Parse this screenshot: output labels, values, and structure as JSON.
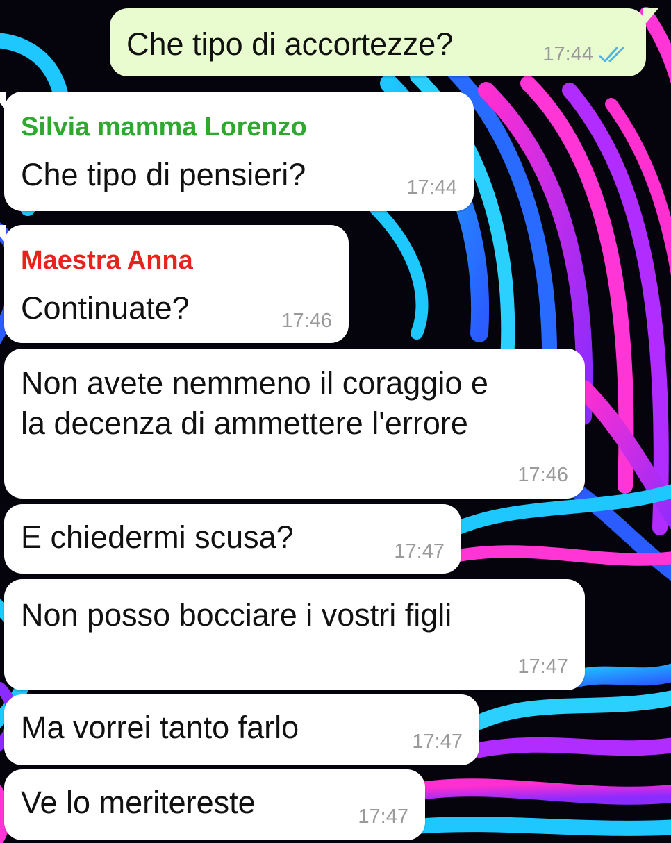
{
  "colors": {
    "incoming_bubble": "#ffffff",
    "outgoing_bubble": "#e8fcd0",
    "text": "#111111",
    "timestamp": "#9a9a9a",
    "read_ticks": "#4fb3e8"
  },
  "messages": [
    {
      "direction": "outgoing",
      "text": "Che tipo di accortezze?",
      "time": "17:44",
      "status_icon": "double-check-read-icon"
    },
    {
      "direction": "incoming",
      "sender": "Silvia mamma Lorenzo",
      "sender_color": "#2ea82e",
      "text": "Che tipo di pensieri?",
      "time": "17:44"
    },
    {
      "direction": "incoming",
      "sender": "Maestra Anna",
      "sender_color": "#e8231e",
      "text": "Continuate?",
      "time": "17:46"
    },
    {
      "direction": "incoming",
      "text_lines": [
        "Non avete nemmeno il coraggio e",
        "la decenza di ammettere l'errore"
      ],
      "time": "17:46"
    },
    {
      "direction": "incoming",
      "text": "E chiedermi scusa?",
      "time": "17:47"
    },
    {
      "direction": "incoming",
      "text": "Non posso bocciare i vostri figli",
      "time": "17:47"
    },
    {
      "direction": "incoming",
      "text": "Ma vorrei tanto farlo",
      "time": "17:47"
    },
    {
      "direction": "incoming",
      "text": "Ve lo meritereste",
      "time": "17:47"
    }
  ]
}
